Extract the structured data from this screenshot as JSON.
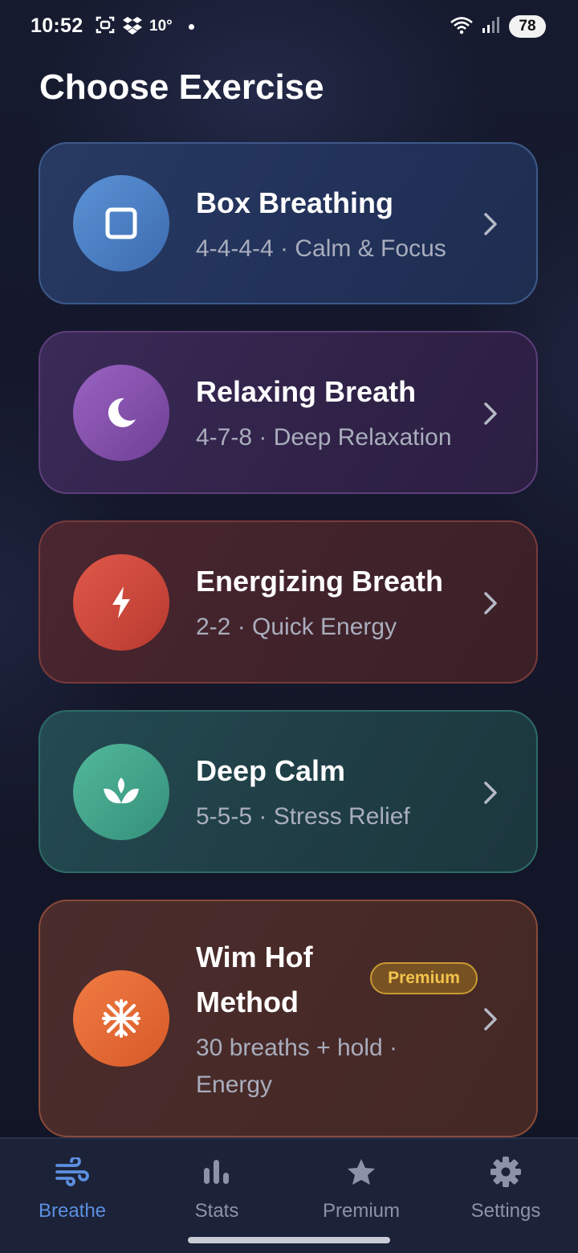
{
  "status_bar": {
    "time": "10:52",
    "temperature": "10°",
    "battery": "78"
  },
  "header": {
    "title": "Choose Exercise"
  },
  "exercises": [
    {
      "title": "Box Breathing",
      "subtitle": "4-4-4-4 · Calm & Focus",
      "icon": "square-icon",
      "color": "#4a7ec4"
    },
    {
      "title": "Relaxing Breath",
      "subtitle": "4-7-8 · Deep Relaxation",
      "icon": "moon-icon",
      "color": "#8552ad"
    },
    {
      "title": "Energizing Breath",
      "subtitle": "2-2 · Quick Energy",
      "icon": "lightning-icon",
      "color": "#cc4a3c"
    },
    {
      "title": "Deep Calm",
      "subtitle": "5-5-5 · Stress Relief",
      "icon": "lotus-icon",
      "color": "#43a48a"
    },
    {
      "title_line1": "Wim Hof",
      "title_line2": "Method",
      "subtitle_line1": "30 breaths + hold ·",
      "subtitle_line2": "Energy",
      "badge": "Premium",
      "icon": "snowflake-icon",
      "color": "#e46a35"
    }
  ],
  "nav": {
    "items": [
      {
        "label": "Breathe",
        "icon": "wind-icon",
        "active": true
      },
      {
        "label": "Stats",
        "icon": "bar-chart-icon",
        "active": false
      },
      {
        "label": "Premium",
        "icon": "star-icon",
        "active": false
      },
      {
        "label": "Settings",
        "icon": "gear-icon",
        "active": false
      }
    ]
  },
  "colors": {
    "accent": "#5b8fe0",
    "premium": "#f3c34d",
    "background": "#141729"
  }
}
